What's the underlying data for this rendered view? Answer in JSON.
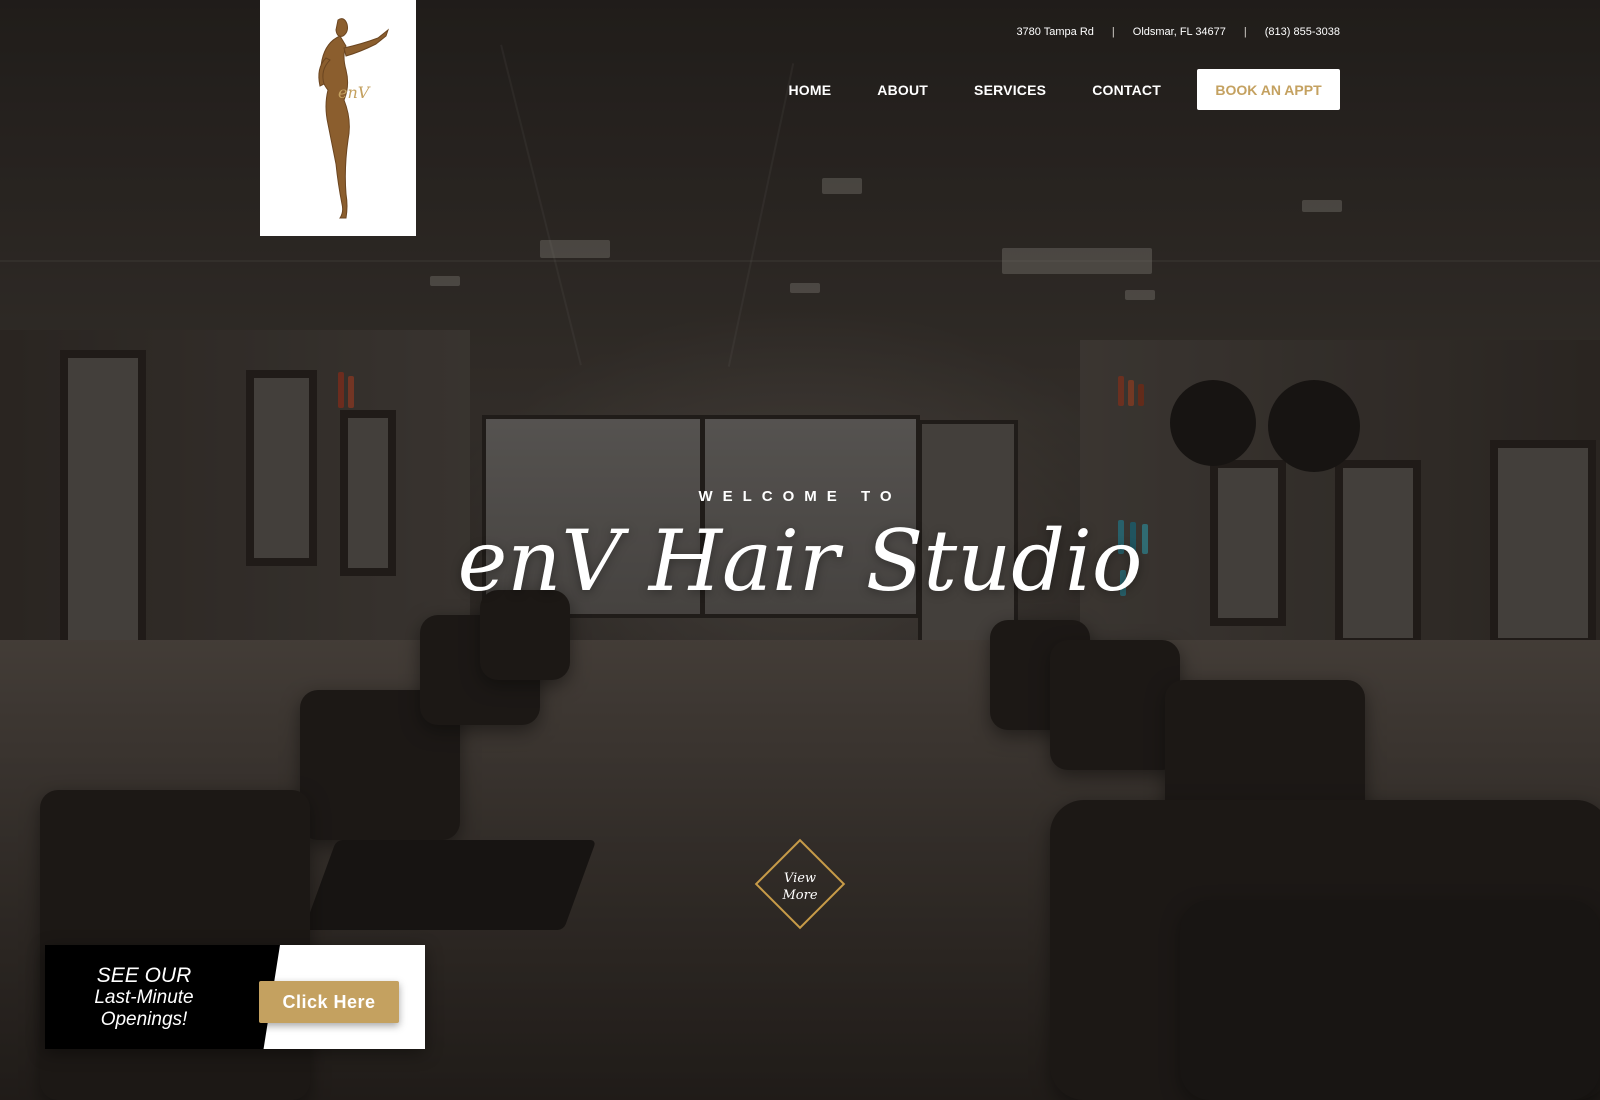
{
  "brand": {
    "logo_icon": "fashion-figure-logo",
    "logo_text": "enV",
    "accent_color": "#c4a160"
  },
  "topbar": {
    "address": "3780 Tampa Rd",
    "separator": "|",
    "city": "Oldsmar, FL 34677",
    "phone": "(813) 855-3038"
  },
  "nav": {
    "items": [
      {
        "label": "HOME"
      },
      {
        "label": "ABOUT"
      },
      {
        "label": "SERVICES"
      },
      {
        "label": "CONTACT"
      }
    ],
    "book_button": "BOOK AN APPT"
  },
  "hero": {
    "welcome": "WELCOME TO",
    "title": "enV Hair Studio",
    "view_more_line1": "View",
    "view_more_line2": "More"
  },
  "promo": {
    "line1": "SEE OUR",
    "line2": "Last-Minute",
    "line3": "Openings!",
    "button": "Click Here"
  }
}
